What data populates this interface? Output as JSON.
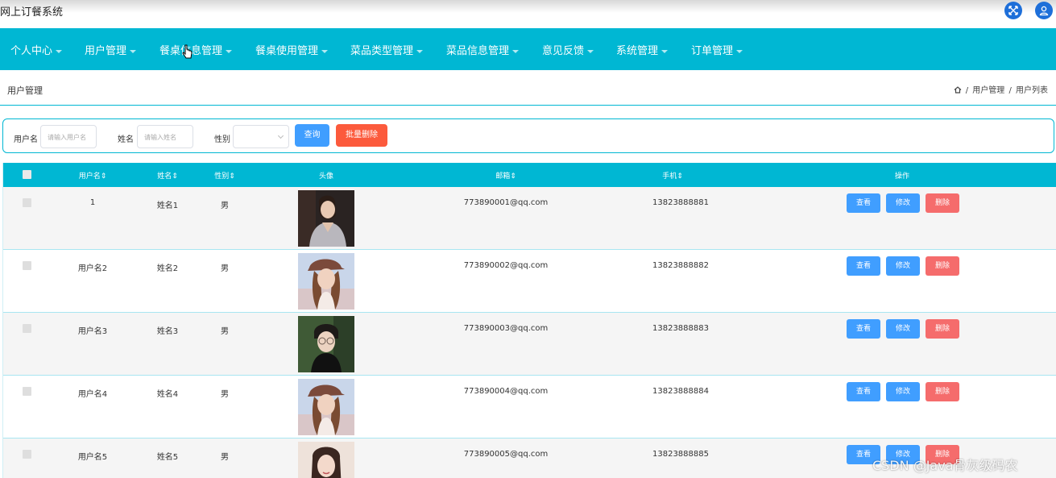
{
  "app": {
    "title": "网上订餐系统"
  },
  "nav": {
    "items": [
      {
        "label": "个人中心"
      },
      {
        "label": "用户管理"
      },
      {
        "label": "餐桌信息管理"
      },
      {
        "label": "餐桌使用管理"
      },
      {
        "label": "菜品类型管理"
      },
      {
        "label": "菜品信息管理"
      },
      {
        "label": "意见反馈"
      },
      {
        "label": "系统管理"
      },
      {
        "label": "订单管理"
      }
    ]
  },
  "breadcrumb": {
    "page_title": "用户管理",
    "path": [
      "用户管理",
      "用户列表"
    ],
    "separator": "/"
  },
  "search": {
    "username_label": "用户名",
    "username_placeholder": "请输入用户名",
    "name_label": "姓名",
    "name_placeholder": "请输入姓名",
    "gender_label": "性别",
    "gender_value": "",
    "query_button": "查询",
    "batch_delete_button": "批量删除"
  },
  "table": {
    "headers": {
      "username": "用户名",
      "name": "姓名",
      "gender": "性别",
      "avatar": "头像",
      "email": "邮箱",
      "phone": "手机",
      "actions": "操作"
    },
    "sort_glyph": "⇕",
    "action_labels": {
      "view": "查看",
      "edit": "修改",
      "delete": "删除"
    },
    "rows": [
      {
        "username": "1",
        "name": "姓名1",
        "gender": "男",
        "email": "773890001@qq.com",
        "phone": "13823888881",
        "avatar_icon": "woman-portrait-dark"
      },
      {
        "username": "用户名2",
        "name": "姓名2",
        "gender": "男",
        "email": "773890002@qq.com",
        "phone": "13823888882",
        "avatar_icon": "woman-portrait-cap"
      },
      {
        "username": "用户名3",
        "name": "姓名3",
        "gender": "男",
        "email": "773890003@qq.com",
        "phone": "13823888883",
        "avatar_icon": "man-portrait-glasses"
      },
      {
        "username": "用户名4",
        "name": "姓名4",
        "gender": "男",
        "email": "773890004@qq.com",
        "phone": "13823888884",
        "avatar_icon": "woman-portrait-cap"
      },
      {
        "username": "用户名5",
        "name": "姓名5",
        "gender": "男",
        "email": "773890005@qq.com",
        "phone": "13823888885",
        "avatar_icon": "woman-portrait-light"
      }
    ]
  },
  "watermark": {
    "text": "CSDN @Java骨灰级码农"
  },
  "colors": {
    "primary": "#00b7d3",
    "button_blue": "#409eff",
    "button_red": "#f56c6c",
    "button_orange": "#fc5a3c",
    "top_icon": "#1e6fd9"
  }
}
